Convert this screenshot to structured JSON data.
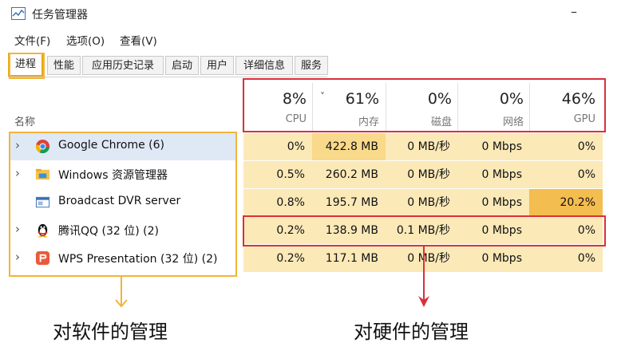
{
  "window": {
    "title": "任务管理器",
    "minimize_glyph": "–"
  },
  "menu": [
    {
      "label": "文件(F)"
    },
    {
      "label": "选项(O)"
    },
    {
      "label": "查看(V)"
    }
  ],
  "tabs": [
    {
      "label": "进程",
      "active": true
    },
    {
      "label": "性能"
    },
    {
      "label": "应用历史记录"
    },
    {
      "label": "启动"
    },
    {
      "label": "用户"
    },
    {
      "label": "详细信息"
    },
    {
      "label": "服务"
    }
  ],
  "columns": {
    "name": "名称",
    "cpu": {
      "pct": "8%",
      "label": "CPU"
    },
    "mem": {
      "pct": "61%",
      "label": "内存",
      "sort_glyph": "˅"
    },
    "disk": {
      "pct": "0%",
      "label": "磁盘"
    },
    "net": {
      "pct": "0%",
      "label": "网络"
    },
    "gpu": {
      "pct": "46%",
      "label": "GPU"
    }
  },
  "processes": [
    {
      "name": "Google Chrome (6)",
      "icon": "chrome-icon",
      "expandable": true,
      "cpu": "0%",
      "mem": "422.8 MB",
      "disk": "0 MB/秒",
      "net": "0 Mbps",
      "gpu": "0%"
    },
    {
      "name": "Windows 资源管理器",
      "icon": "folder-icon",
      "expandable": true,
      "cpu": "0.5%",
      "mem": "260.2 MB",
      "disk": "0 MB/秒",
      "net": "0 Mbps",
      "gpu": "0%"
    },
    {
      "name": "Broadcast DVR server",
      "icon": "window-icon",
      "expandable": false,
      "cpu": "0.8%",
      "mem": "195.7 MB",
      "disk": "0 MB/秒",
      "net": "0 Mbps",
      "gpu": "20.2%"
    },
    {
      "name": "腾讯QQ (32 位) (2)",
      "icon": "qq-penguin-icon",
      "expandable": true,
      "cpu": "0.2%",
      "mem": "138.9 MB",
      "disk": "0.1 MB/秒",
      "net": "0 Mbps",
      "gpu": "0%"
    },
    {
      "name": "WPS Presentation (32 位) (2)",
      "icon": "wps-presentation-icon",
      "expandable": true,
      "cpu": "0.2%",
      "mem": "117.1 MB",
      "disk": "0 MB/秒",
      "net": "0 Mbps",
      "gpu": "0%"
    }
  ],
  "annotations": {
    "software_caption": "对软件的管理",
    "hardware_caption": "对硬件的管理",
    "colors": {
      "orange": "#f2b43b",
      "red": "#d9303a",
      "heat_low": "#fbe9b8",
      "heat_mid": "#f9d98a",
      "heat_high": "#f4bd4f"
    }
  }
}
